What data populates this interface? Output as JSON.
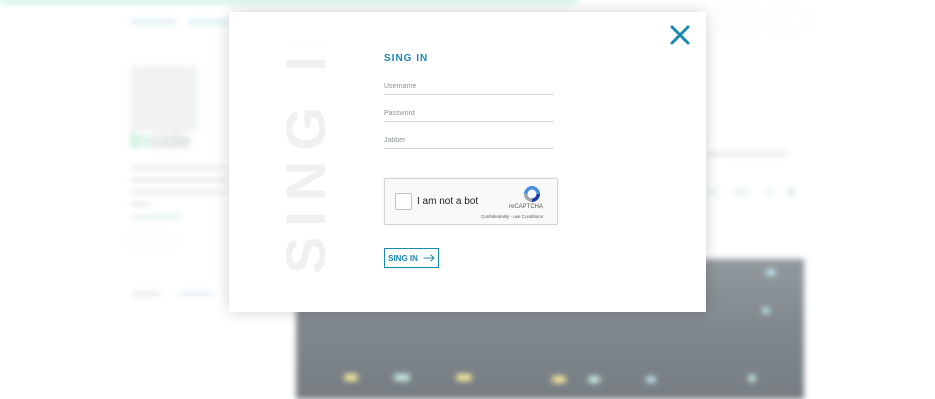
{
  "modal": {
    "watermark": "SING IN",
    "title": "SING IN",
    "username_placeholder": "Username",
    "password_placeholder": "Password",
    "jabber_placeholder": "Jabber",
    "submit_label": "SING IN",
    "close_icon": "close-icon",
    "accent_color": "#1b88b2"
  },
  "captcha": {
    "label": "I am not a bot",
    "brand": "reCAPTCHA",
    "links": "Confidentiality - use Conditions",
    "checked": false
  },
  "background": {
    "logo_text_prefix": "In",
    "logo_text_suffix": "side"
  }
}
